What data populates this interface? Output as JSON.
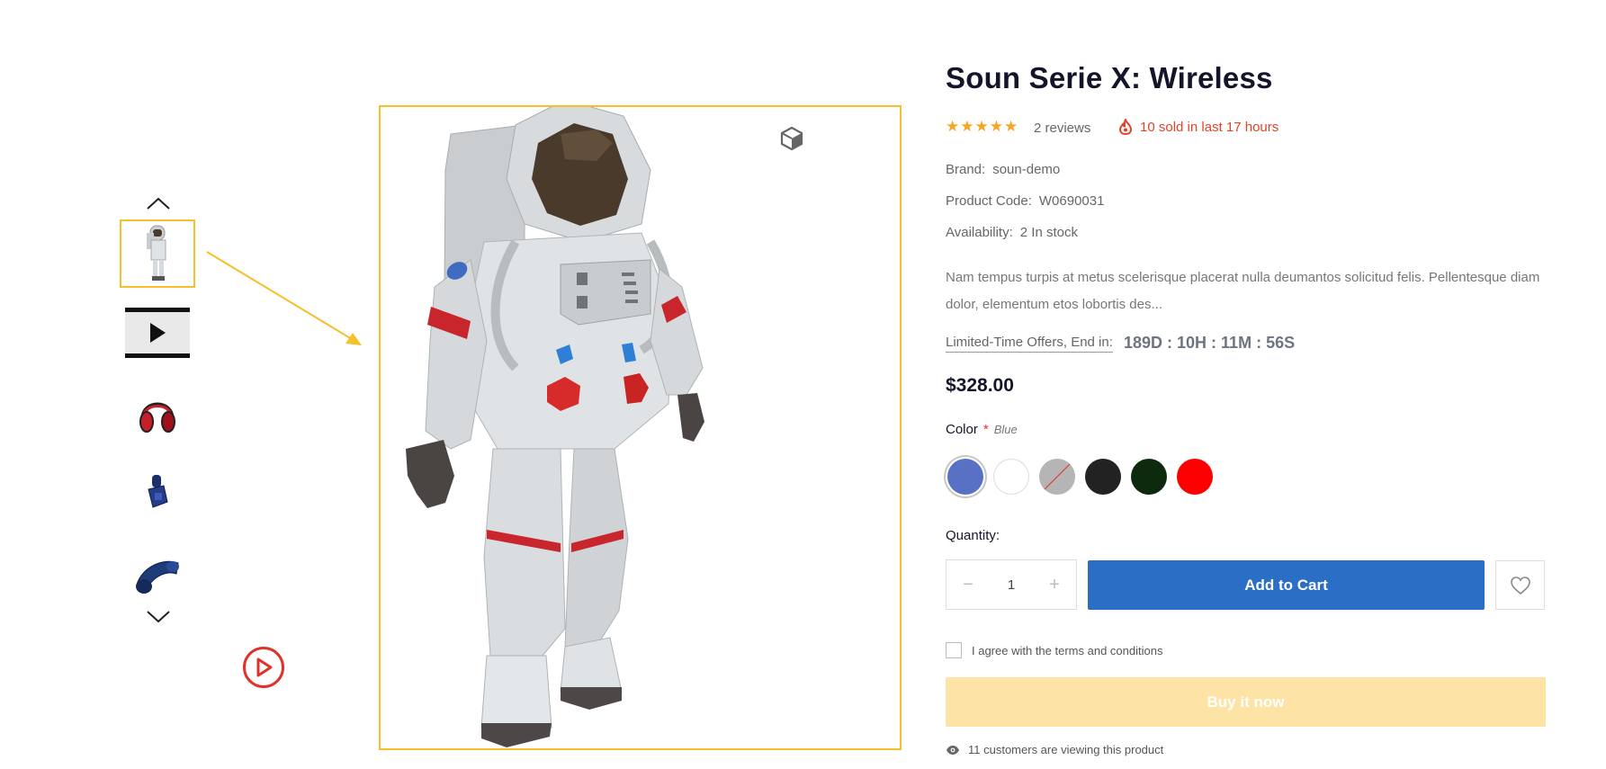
{
  "product": {
    "title": "Soun Serie X: Wireless",
    "stars": "★★★★★",
    "reviews": "2 reviews",
    "sold_text": "10 sold in last 17 hours",
    "brand_label": "Brand:",
    "brand_value": "soun-demo",
    "code_label": "Product Code:",
    "code_value": "W0690031",
    "availability_label": "Availability:",
    "availability_value": "2 In stock",
    "description": "Nam tempus turpis at metus scelerisque placerat nulla deumantos solicitud felis. Pellentesque diam dolor, elementum etos lobortis des...",
    "offer_label": "Limited-Time Offers, End in:",
    "countdown": "189D : 10H : 11M : 56S",
    "price": "$328.00"
  },
  "color": {
    "label": "Color",
    "required_mark": "*",
    "selected": "Blue",
    "swatches": [
      {
        "name": "Blue",
        "hex": "#5871c4"
      },
      {
        "name": "White",
        "hex": "#ffffff"
      },
      {
        "name": "Grey",
        "hex": "#b5b5b5",
        "unavailable": true
      },
      {
        "name": "Black",
        "hex": "#222222"
      },
      {
        "name": "Dark Green",
        "hex": "#0e2a0e"
      },
      {
        "name": "Red",
        "hex": "#ff0000"
      }
    ]
  },
  "quantity": {
    "label": "Quantity:",
    "value": "1",
    "minus": "−",
    "plus": "+"
  },
  "actions": {
    "add_to_cart": "Add to Cart",
    "terms": "I agree with the terms and conditions",
    "buy_now": "Buy it now"
  },
  "viewers": "11 customers are viewing this product",
  "colors": {
    "accent_blue": "#2a6ec5",
    "highlight_yellow": "#f6c02a",
    "buy_now_bg": "#fde4a6",
    "hot_red": "#e0432a",
    "star": "#f5a623",
    "title": "#14152b"
  },
  "icons": {
    "gallery_up": "chevron-up-icon",
    "gallery_down": "chevron-down-icon",
    "video": "play-icon",
    "ar": "cube-icon",
    "sold": "fire-icon",
    "wishlist": "heart-icon",
    "viewers": "eye-icon"
  }
}
